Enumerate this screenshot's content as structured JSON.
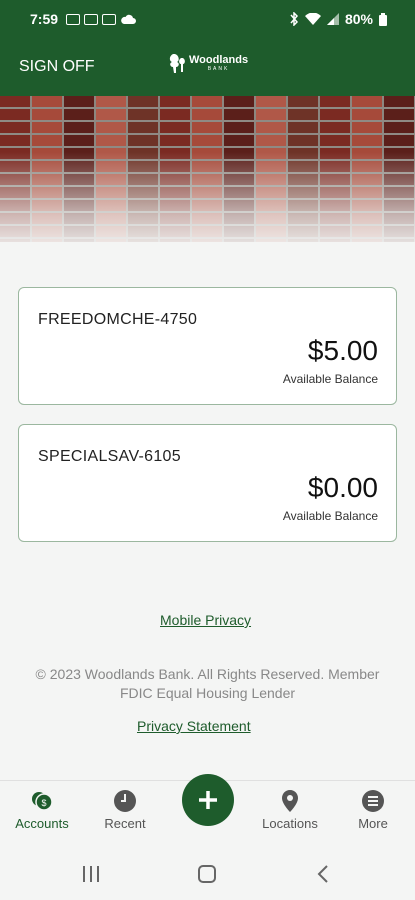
{
  "status_bar": {
    "time": "7:59",
    "battery": "80%",
    "icons_left": [
      "sync-icon",
      "gallery-icon",
      "image-icon",
      "cloud-icon"
    ],
    "icons_right": [
      "bluetooth-icon",
      "wifi-icon",
      "signal-icon",
      "battery-icon"
    ]
  },
  "header": {
    "sign_off_label": "SIGN OFF",
    "logo_name": "Woodlands",
    "logo_sub": "BANK"
  },
  "accounts": [
    {
      "name": "FREEDOMCHE-4750",
      "balance": "$5.00",
      "balance_label": "Available Balance"
    },
    {
      "name": "SPECIALSAV-6105",
      "balance": "$0.00",
      "balance_label": "Available Balance"
    }
  ],
  "footer": {
    "mobile_privacy": "Mobile Privacy",
    "copyright": "© 2023 Woodlands Bank. All Rights Reserved. Member FDIC Equal Housing Lender",
    "privacy_statement": "Privacy Statement"
  },
  "bottom_nav": {
    "accounts": "Accounts",
    "recent": "Recent",
    "locations": "Locations",
    "more": "More"
  },
  "colors": {
    "brand_green": "#1e5c2c",
    "background": "#f4f5f4",
    "card_border": "#9bb79f"
  }
}
